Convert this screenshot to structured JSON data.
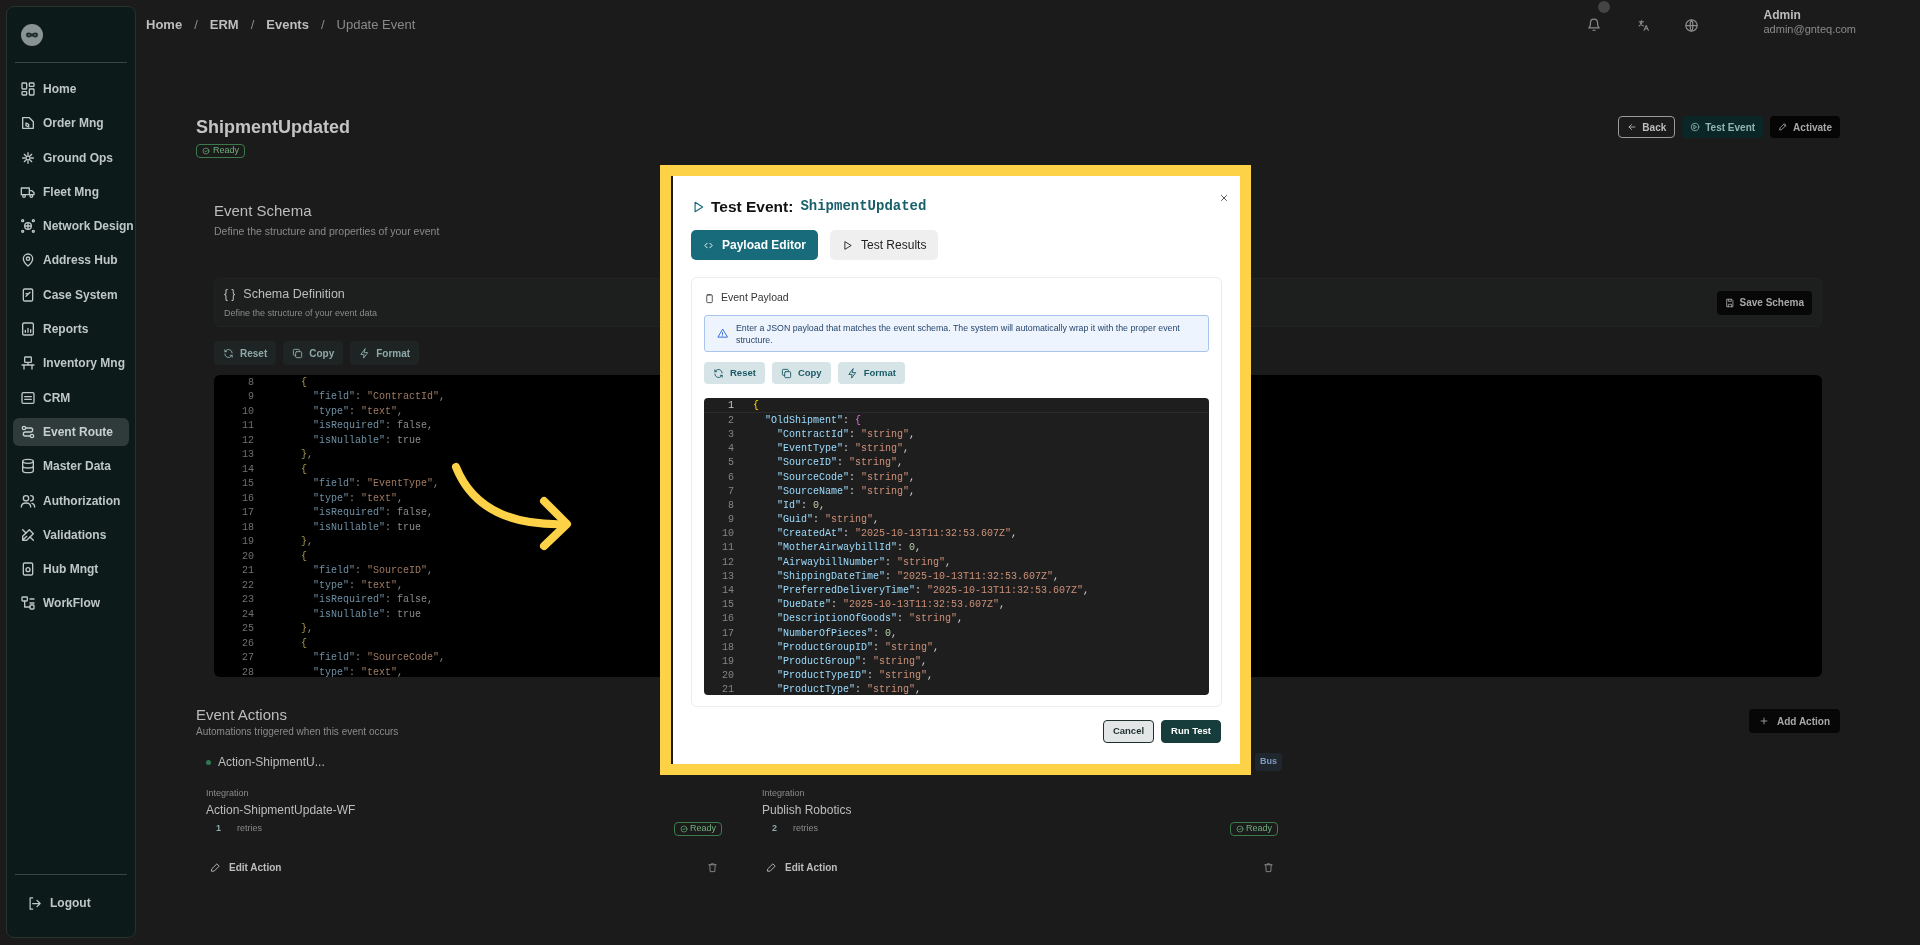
{
  "sidebar": {
    "items": [
      {
        "label": "Home",
        "selected": false
      },
      {
        "label": "Order Mng",
        "selected": false
      },
      {
        "label": "Ground Ops",
        "selected": false
      },
      {
        "label": "Fleet Mng",
        "selected": false
      },
      {
        "label": "Network Design",
        "selected": false
      },
      {
        "label": "Address Hub",
        "selected": false
      },
      {
        "label": "Case System",
        "selected": false
      },
      {
        "label": "Reports",
        "selected": false
      },
      {
        "label": "Inventory Mng",
        "selected": false
      },
      {
        "label": "CRM",
        "selected": false
      },
      {
        "label": "Event Route",
        "selected": true
      },
      {
        "label": "Master Data",
        "selected": false
      },
      {
        "label": "Authorization",
        "selected": false
      },
      {
        "label": "Validations",
        "selected": false
      },
      {
        "label": "Hub Mngt",
        "selected": false
      },
      {
        "label": "WorkFlow",
        "selected": false
      }
    ],
    "logout": "Logout"
  },
  "header": {
    "breadcrumbs": [
      "Home",
      "ERM",
      "Events",
      "Update Event"
    ],
    "separators": [
      "/",
      "/",
      "/"
    ],
    "user": {
      "name": "Admin",
      "email": "admin@gnteq.com"
    }
  },
  "page": {
    "title": "ShipmentUpdated",
    "status": "Ready",
    "buttons": [
      {
        "label": "Back",
        "kind": "outline"
      },
      {
        "label": "Test Event",
        "kind": "teal"
      },
      {
        "label": "Activate",
        "kind": "dark"
      }
    ]
  },
  "schema": {
    "title": "Event Schema",
    "subtitle": "Define the structure and properties of your event",
    "card_icon": "{ }",
    "card_title": "Schema Definition",
    "card_subtitle": "Define the structure of your event data",
    "save_button": "Save Schema",
    "tools": [
      "Reset",
      "Copy",
      "Format"
    ],
    "code": [
      {
        "number": "8",
        "text": "      {"
      },
      {
        "number": "9",
        "text": "        \"field\": \"ContractId\","
      },
      {
        "number": "10",
        "text": "        \"type\": \"text\","
      },
      {
        "number": "11",
        "text": "        \"isRequired\": false,"
      },
      {
        "number": "12",
        "text": "        \"isNullable\": true"
      },
      {
        "number": "13",
        "text": "      },"
      },
      {
        "number": "14",
        "text": "      {"
      },
      {
        "number": "15",
        "text": "        \"field\": \"EventType\","
      },
      {
        "number": "16",
        "text": "        \"type\": \"text\","
      },
      {
        "number": "17",
        "text": "        \"isRequired\": false,"
      },
      {
        "number": "18",
        "text": "        \"isNullable\": true"
      },
      {
        "number": "19",
        "text": "      },"
      },
      {
        "number": "20",
        "text": "      {"
      },
      {
        "number": "21",
        "text": "        \"field\": \"SourceID\","
      },
      {
        "number": "22",
        "text": "        \"type\": \"text\","
      },
      {
        "number": "23",
        "text": "        \"isRequired\": false,"
      },
      {
        "number": "24",
        "text": "        \"isNullable\": true"
      },
      {
        "number": "25",
        "text": "      },"
      },
      {
        "number": "26",
        "text": "      {"
      },
      {
        "number": "27",
        "text": "        \"field\": \"SourceCode\","
      },
      {
        "number": "28",
        "text": "        \"type\": \"text\","
      }
    ]
  },
  "actions": {
    "title": "Event Actions",
    "subtitle": "Automations triggered when this event occurs",
    "add_button": "Add Action",
    "cards": [
      {
        "title": "Action-ShipmentU...",
        "integration_label": "Integration",
        "integration": "Action-ShipmentUpdate-WF",
        "retries_count": "1",
        "retries_label": "retries",
        "status": "Ready",
        "edit": "Edit Action"
      },
      {
        "tag": "Bus",
        "integration_label": "Integration",
        "integration": "Publish Robotics",
        "retries_count": "2",
        "retries_label": "retries",
        "status": "Ready",
        "edit": "Edit Action"
      }
    ]
  },
  "dialog": {
    "title": "Test Event:",
    "event_name": "ShipmentUpdated",
    "tabs": [
      {
        "label": "Payload Editor",
        "selected": true
      },
      {
        "label": "Test Results",
        "selected": false
      }
    ],
    "section_title": "Event Payload",
    "info": "Enter a JSON payload that matches the event schema. The system will automatically wrap it with the proper event structure.",
    "tools": [
      "Reset",
      "Copy",
      "Format"
    ],
    "code": [
      {
        "number": "1",
        "text": "{"
      },
      {
        "number": "2",
        "text": "  \"OldShipment\": {"
      },
      {
        "number": "3",
        "text": "    \"ContractId\": \"string\","
      },
      {
        "number": "4",
        "text": "    \"EventType\": \"string\","
      },
      {
        "number": "5",
        "text": "    \"SourceID\": \"string\","
      },
      {
        "number": "6",
        "text": "    \"SourceCode\": \"string\","
      },
      {
        "number": "7",
        "text": "    \"SourceName\": \"string\","
      },
      {
        "number": "8",
        "text": "    \"Id\": 0,"
      },
      {
        "number": "9",
        "text": "    \"Guid\": \"string\","
      },
      {
        "number": "10",
        "text": "    \"CreatedAt\": \"2025-10-13T11:32:53.607Z\","
      },
      {
        "number": "11",
        "text": "    \"MotherAirwaybillId\": 0,"
      },
      {
        "number": "12",
        "text": "    \"AirwaybillNumber\": \"string\","
      },
      {
        "number": "13",
        "text": "    \"ShippingDateTime\": \"2025-10-13T11:32:53.607Z\","
      },
      {
        "number": "14",
        "text": "    \"PreferredDeliveryTime\": \"2025-10-13T11:32:53.607Z\","
      },
      {
        "number": "15",
        "text": "    \"DueDate\": \"2025-10-13T11:32:53.607Z\","
      },
      {
        "number": "16",
        "text": "    \"DescriptionOfGoods\": \"string\","
      },
      {
        "number": "17",
        "text": "    \"NumberOfPieces\": 0,"
      },
      {
        "number": "18",
        "text": "    \"ProductGroupID\": \"string\","
      },
      {
        "number": "19",
        "text": "    \"ProductGroup\": \"string\","
      },
      {
        "number": "20",
        "text": "    \"ProductTypeID\": \"string\","
      },
      {
        "number": "21",
        "text": "    \"ProductType\": \"string\","
      }
    ],
    "buttons": [
      {
        "label": "Cancel",
        "kind": "secondary"
      },
      {
        "label": "Run Test",
        "kind": "primary"
      }
    ]
  }
}
